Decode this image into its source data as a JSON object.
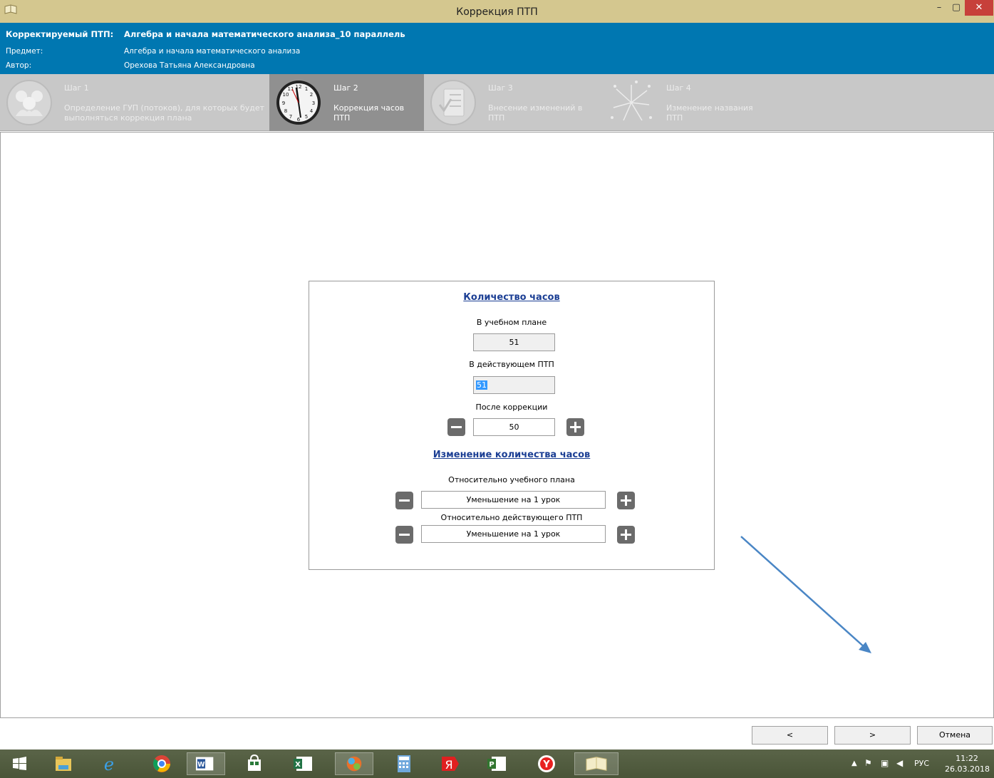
{
  "window": {
    "title": "Коррекция ПТП",
    "minimize": "–",
    "maximize": "▢",
    "close": "✕"
  },
  "header": {
    "ptp_label": "Корректируемый ПТП:",
    "ptp_value": "Алгебра и начала математического анализа_10 параллель",
    "subject_label": "Предмет:",
    "subject_value": "Алгебра и начала математического анализа",
    "author_label": "Автор:",
    "author_value": "Орехова  Татьяна  Александровна"
  },
  "steps": [
    {
      "num": "Шаг 1",
      "desc": "Определение ГУП (потоков), для которых будет выполняться коррекция плана",
      "icon": "people-icon",
      "active": false
    },
    {
      "num": "Шаг 2",
      "desc": "Коррекция часов ПТП",
      "icon": "clock-icon",
      "active": true
    },
    {
      "num": "Шаг 3",
      "desc": "Внесение изменений в ПТП",
      "icon": "checklist-icon",
      "active": false
    },
    {
      "num": "Шаг 4",
      "desc": "Изменение названия ПТП",
      "icon": "sparkle-icon",
      "active": false
    }
  ],
  "hours": {
    "title": "Количество часов",
    "curriculum_label": "В учебном плане",
    "curriculum_value": "51",
    "current_label": "В действующем ПТП",
    "current_value": "51",
    "after_label": "После коррекции",
    "after_value": "50"
  },
  "change": {
    "title": "Изменение количества часов",
    "rel_curriculum_label": "Относительно учебного плана",
    "rel_curriculum_value": "Уменьшение на 1 урок",
    "rel_current_label": "Относительно действующего ПТП",
    "rel_current_value": "Уменьшение на 1 урок"
  },
  "buttons": {
    "prev": "<",
    "next": ">",
    "cancel": "Отмена"
  },
  "taskbar": {
    "apps": [
      "start-icon",
      "file-explorer-icon",
      "ie-icon",
      "chrome-icon",
      "word-icon",
      "store-icon",
      "excel-icon",
      "app-icon",
      "calculator-icon",
      "yandex-icon",
      "project-icon",
      "yandex-browser-icon",
      "book-icon"
    ],
    "language": "РУС",
    "time": "11:22",
    "date": "26.03.2018"
  },
  "colors": {
    "title_bar": "#d4c78f",
    "header": "#0077b1",
    "section_title": "#1c3f94",
    "arrow": "#4a86c5"
  }
}
